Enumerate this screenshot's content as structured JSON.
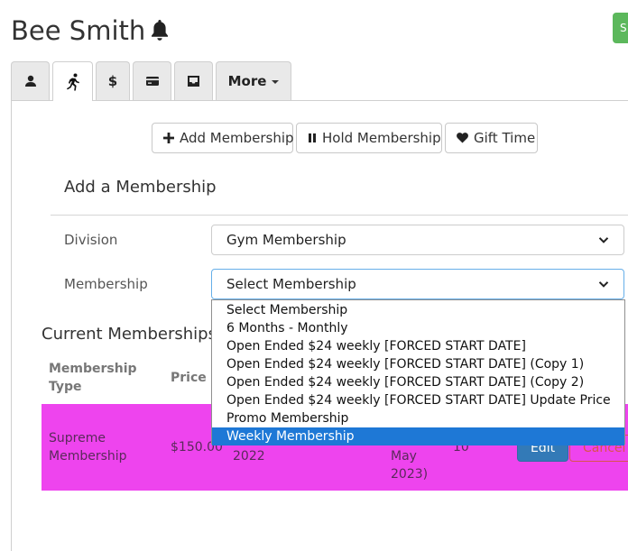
{
  "header": {
    "title": "Bee Smith",
    "corner_button_label": "S"
  },
  "tabs": [
    {
      "icon": "user-icon",
      "active": false
    },
    {
      "icon": "running-icon",
      "active": true
    },
    {
      "icon": "dollar-icon",
      "label": "$",
      "active": false
    },
    {
      "icon": "credit-card-icon",
      "active": false
    },
    {
      "icon": "inbox-icon",
      "active": false
    },
    {
      "label": "More",
      "active": false
    }
  ],
  "actions": {
    "add_membership": "Add Membership",
    "hold_membership": "Hold Membership",
    "gift_time": "Gift Time"
  },
  "add_form": {
    "title": "Add a Membership",
    "division_label": "Division",
    "division_value": "Gym Membership",
    "membership_label": "Membership",
    "membership_value": "Select Membership",
    "options": [
      "Select Membership",
      "6 Months - Monthly",
      "Open Ended $24 weekly [FORCED START DATE]",
      "Open Ended $24 weekly [FORCED START DATE] (Copy 1)",
      "Open Ended $24 weekly [FORCED START DATE] (Copy 2)",
      "Open Ended $24 weekly [FORCED START DATE] Update Price",
      "Promo Membership",
      "Weekly Membership"
    ],
    "highlighted_option": "Weekly Membership"
  },
  "current": {
    "title": "Current Memberships",
    "columns": {
      "type_line1": "Membership",
      "type_line2": "Type",
      "price": "Price"
    },
    "rows": [
      {
        "type_line1": "Supreme",
        "type_line2": "Membership",
        "price": "$150.00",
        "start_year": "2022",
        "end_line1": "May",
        "end_line2": "2023)",
        "count": "10",
        "edit_label": "Edit",
        "cancel_label": "Cancel"
      }
    ]
  },
  "colors": {
    "row_highlight": "#ee44ee",
    "primary": "#337ab7",
    "danger": "#d9534f",
    "success": "#5cb85c",
    "dropdown_selected": "#1e78d6"
  }
}
